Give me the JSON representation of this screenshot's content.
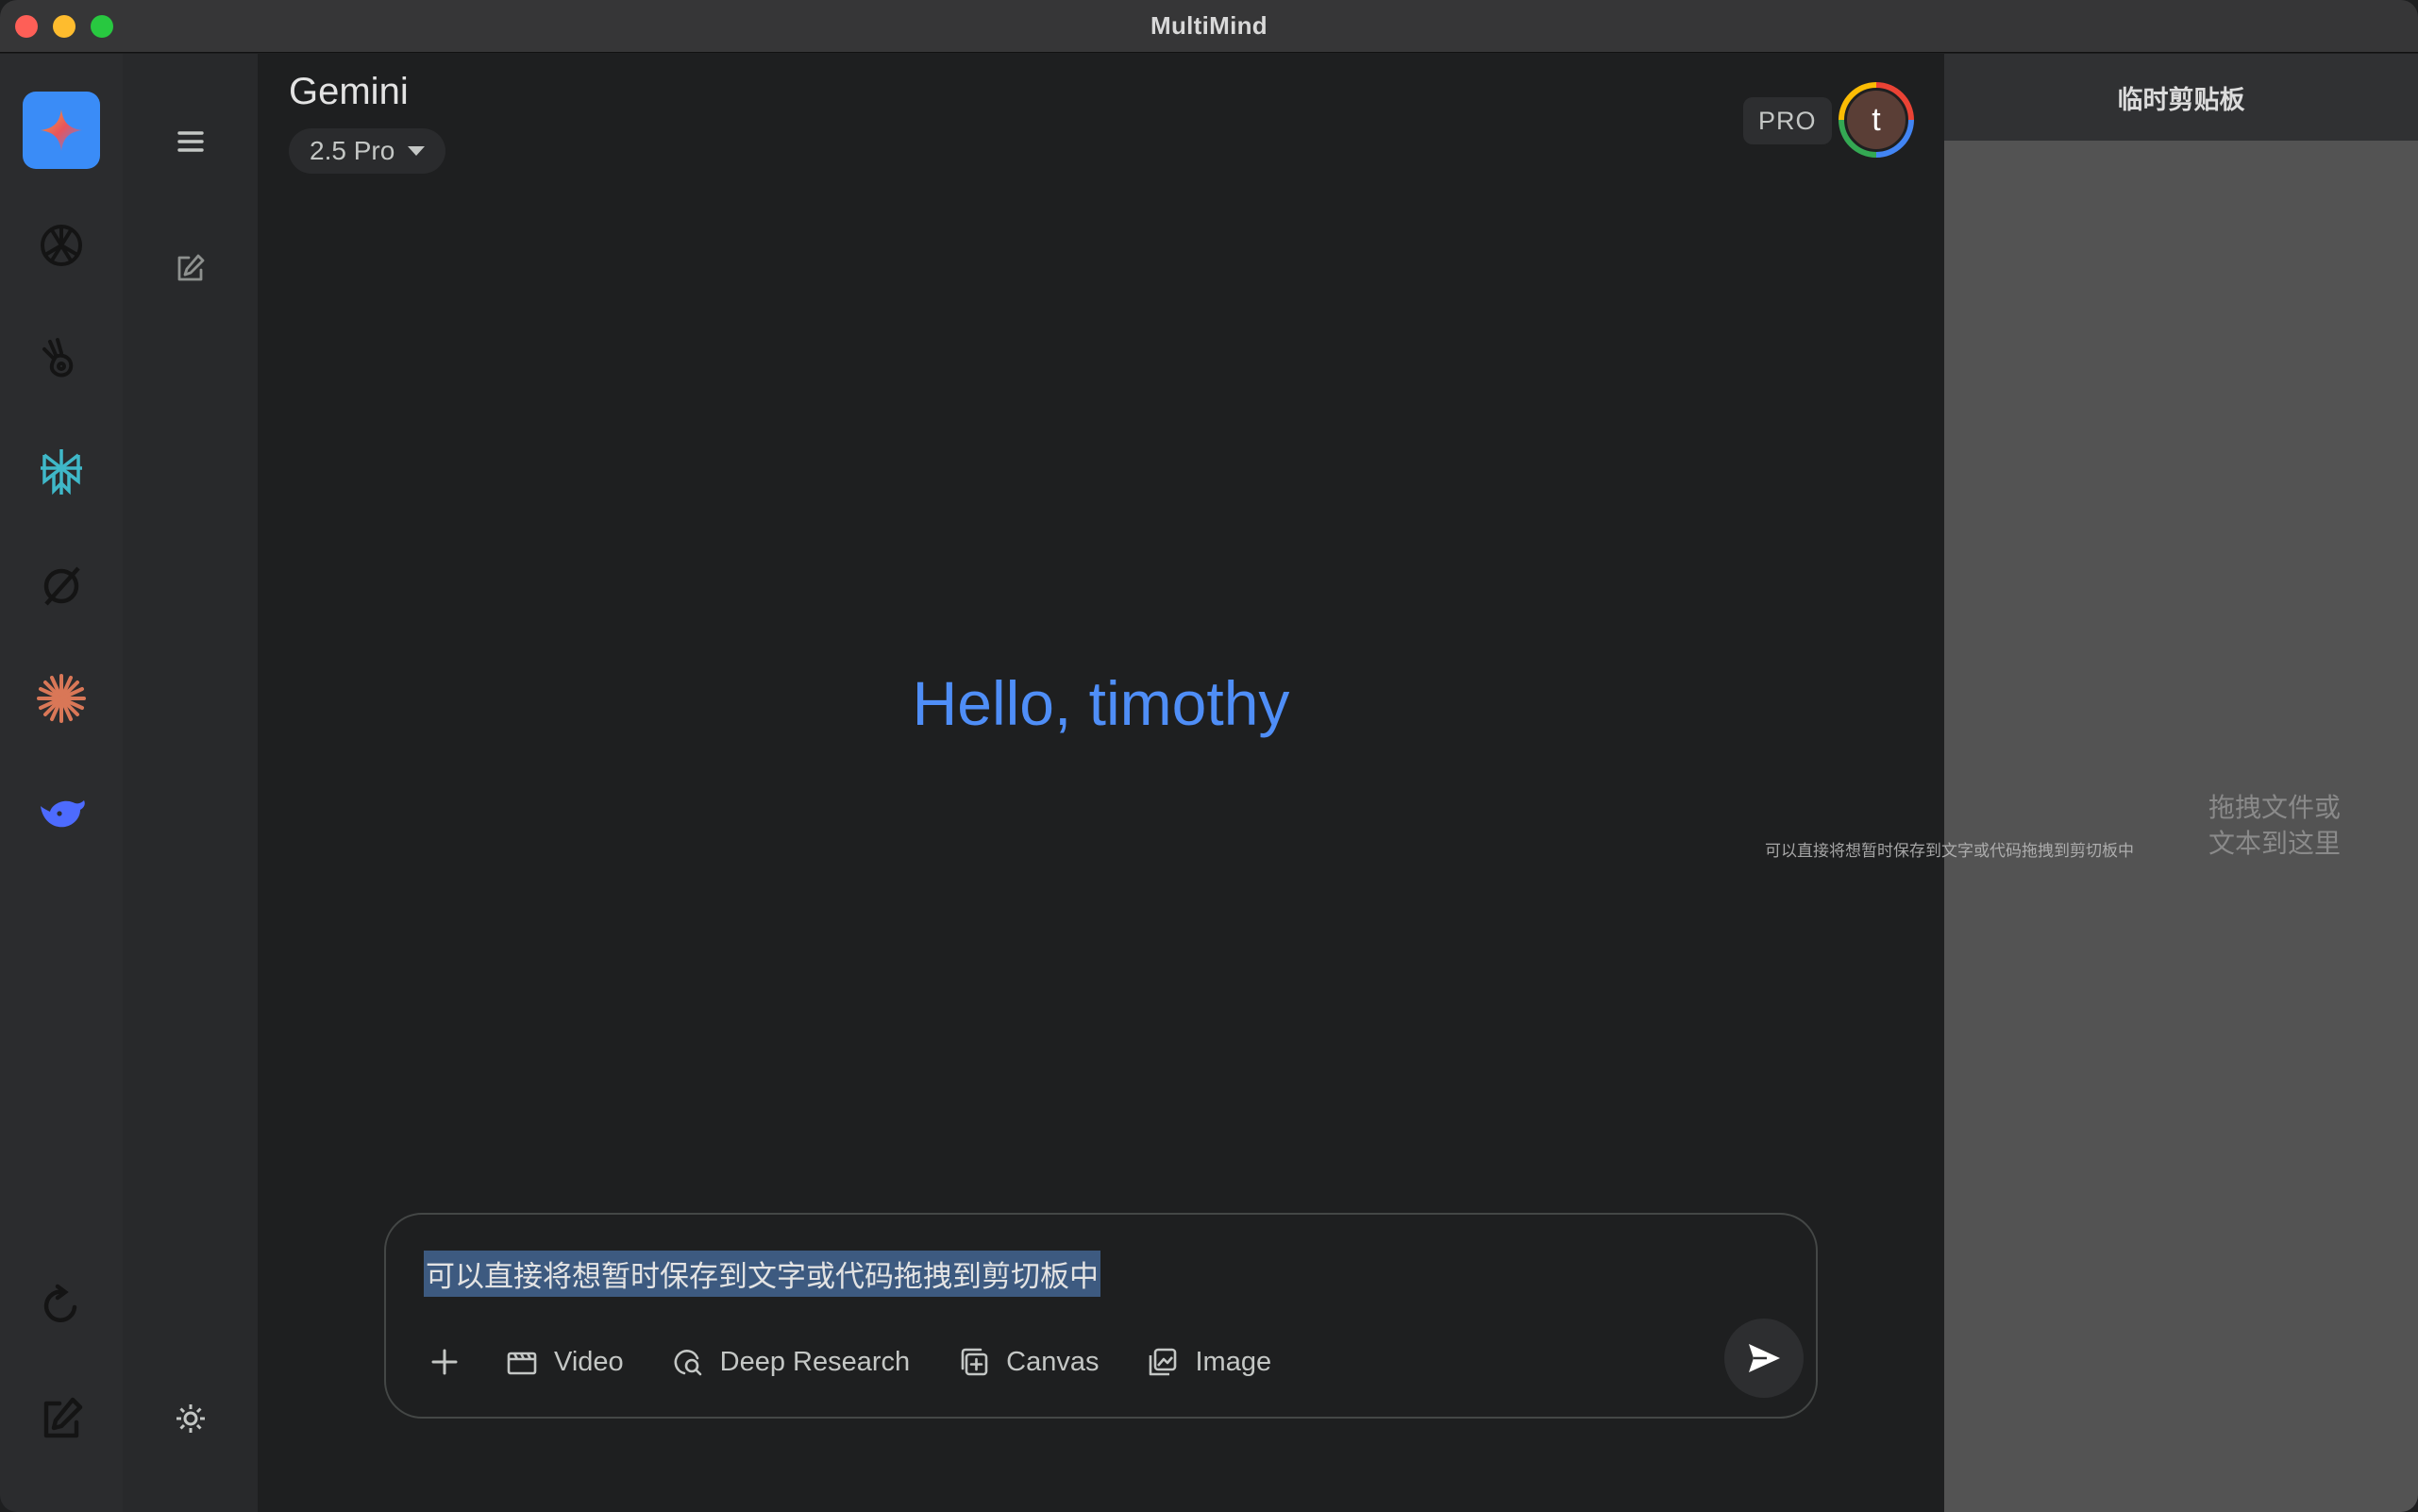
{
  "window": {
    "title": "MultiMind"
  },
  "rail": {
    "items": [
      {
        "name": "Gemini",
        "icon": "gemini-sparkle-icon",
        "active": true
      },
      {
        "name": "ChatGPT",
        "icon": "openai-knot-icon"
      },
      {
        "name": "Grok",
        "icon": "grok-hand-icon"
      },
      {
        "name": "Perplexity",
        "icon": "perplexity-icon"
      },
      {
        "name": "Grok X",
        "icon": "slashed-circle-icon"
      },
      {
        "name": "Claude",
        "icon": "claude-starburst-icon"
      },
      {
        "name": "DeepSeek",
        "icon": "deepseek-whale-icon"
      }
    ],
    "bottom": [
      {
        "icon": "refresh-icon"
      },
      {
        "icon": "edit-icon"
      }
    ]
  },
  "sidebar": {
    "menu_icon": "hamburger-menu-icon",
    "new_chat_icon": "new-chat-icon",
    "settings_icon": "settings-gear-icon"
  },
  "header": {
    "model_name": "Gemini",
    "model_version": "2.5 Pro",
    "plan_badge": "PRO",
    "avatar_initial": "t"
  },
  "greeting": "Hello, timothy",
  "composer": {
    "input_value": "可以直接将想暂时保存到文字或代码拖拽到剪切板中",
    "tools": [
      {
        "label": "Video",
        "icon": "video-clapper-icon"
      },
      {
        "label": "Deep Research",
        "icon": "deep-research-icon"
      },
      {
        "label": "Canvas",
        "icon": "canvas-icon"
      },
      {
        "label": "Image",
        "icon": "image-icon"
      }
    ]
  },
  "clipboard": {
    "title": "临时剪贴板",
    "hint_line1": "拖拽文件或",
    "hint_line2": "文本到这里",
    "drag_preview": "可以直接将想暂时保存到文字或代码拖拽到剪切板中"
  },
  "colors": {
    "accent": "#3a8cf7",
    "greeting": "#4f8ef7",
    "selection": "#3d5a80"
  }
}
